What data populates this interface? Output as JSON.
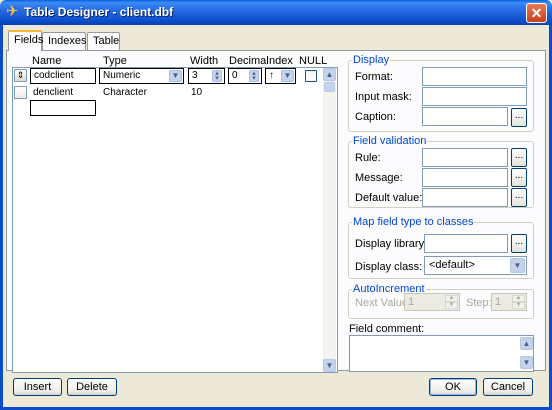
{
  "window": {
    "title": "Table Designer - client.dbf",
    "close_glyph": "✕"
  },
  "tabs": [
    {
      "label": "Fields",
      "active": true
    },
    {
      "label": "Indexes",
      "active": false
    },
    {
      "label": "Table",
      "active": false
    }
  ],
  "grid": {
    "headers": [
      "Name",
      "Type",
      "Width",
      "Decimal",
      "Index",
      "NULL"
    ],
    "rows": [
      {
        "name": "codclient",
        "type": "Numeric",
        "width": "3",
        "decimal": "0",
        "index_glyph": "↑",
        "null": false,
        "editing": true
      },
      {
        "name": "denclient",
        "type": "Character",
        "width": "10"
      },
      {
        "name": ""
      }
    ]
  },
  "display": {
    "title": "Display",
    "format_label": "Format:",
    "input_mask_label": "Input mask:",
    "caption_label": "Caption:",
    "format_value": "",
    "input_mask_value": "",
    "caption_value": ""
  },
  "field_validation": {
    "title": "Field validation",
    "rule_label": "Rule:",
    "message_label": "Message:",
    "default_value_label": "Default value:"
  },
  "map_field_type": {
    "title": "Map field type to classes",
    "display_library_label": "Display library:",
    "display_class_label": "Display class:",
    "display_class_value": "<default>"
  },
  "autoincrement": {
    "title": "AutoIncrement",
    "next_value_label": "Next Value:",
    "next_value": "1",
    "step_label": "Step:",
    "step_value": "1"
  },
  "field_comment": {
    "label": "Field comment:"
  },
  "buttons": {
    "insert": "Insert",
    "delete": "Delete",
    "ok": "OK",
    "cancel": "Cancel",
    "ellipsis": "..."
  },
  "icons": {
    "arrow_down": "▼",
    "arrow_up": "▲",
    "updown": "⇕",
    "app_icon": "✈"
  },
  "colors": {
    "title_bar": "#0b4cc9",
    "group_title": "#0046d5",
    "window_bg": "#ece9d8"
  }
}
